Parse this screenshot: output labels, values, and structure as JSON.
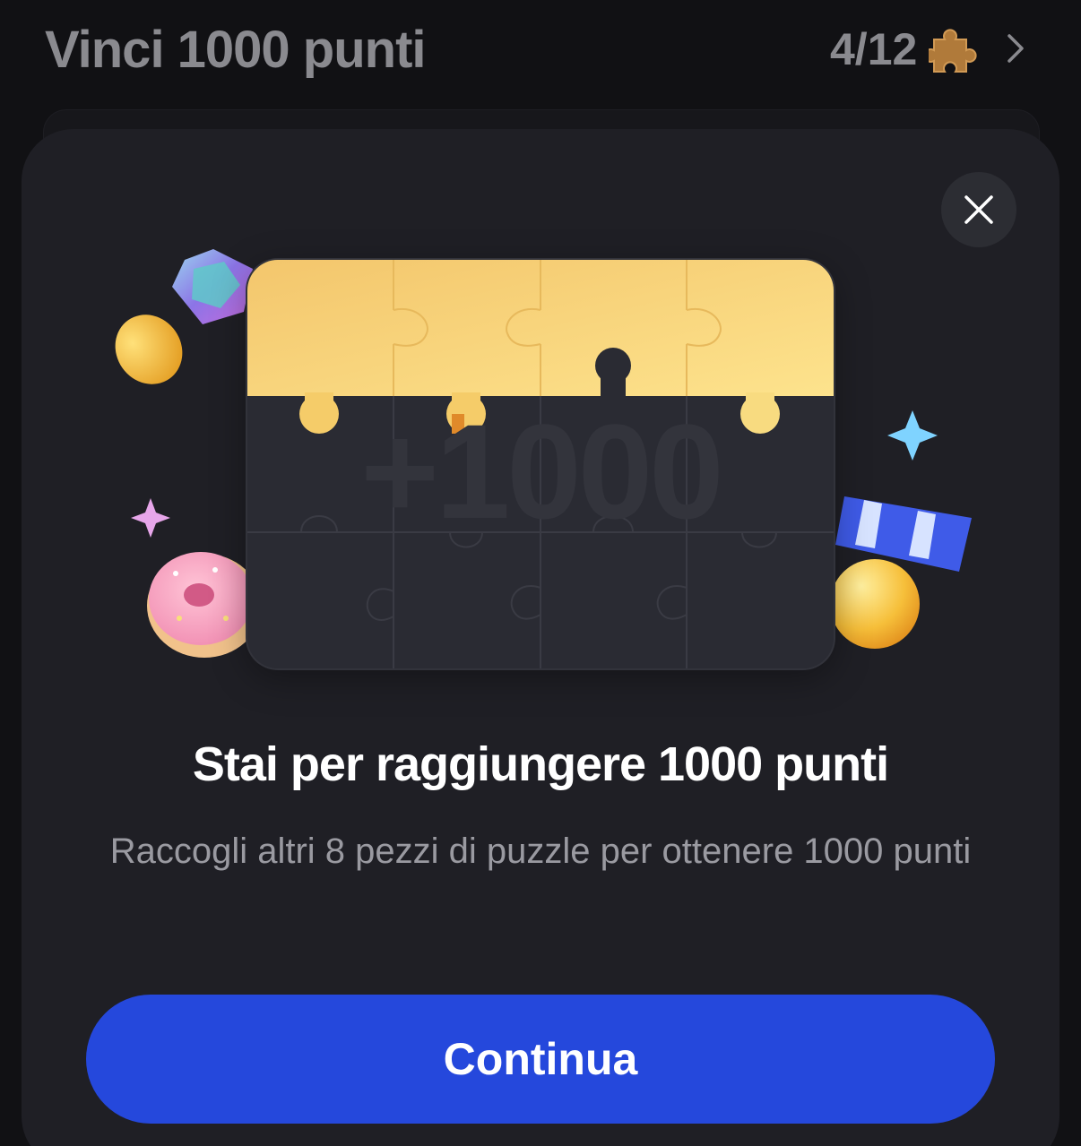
{
  "background": {
    "title": "Vinci 1000 punti",
    "progress": "4/12"
  },
  "modal": {
    "bonus_text": "+1000",
    "headline": "Stai per raggiungere 1000 punti",
    "subtext": "Raccogli altri 8 pezzi di puzzle per ottenere 1000 punti",
    "continue_label": "Continua"
  },
  "icons": {
    "close": "close-icon",
    "puzzle": "puzzle-piece-icon",
    "chevron": "chevron-right-icon"
  },
  "colors": {
    "accent": "#2548dc",
    "puzzle_gold": "#f7cf6a",
    "modal_bg": "#1f1f25",
    "page_bg": "#111114"
  }
}
